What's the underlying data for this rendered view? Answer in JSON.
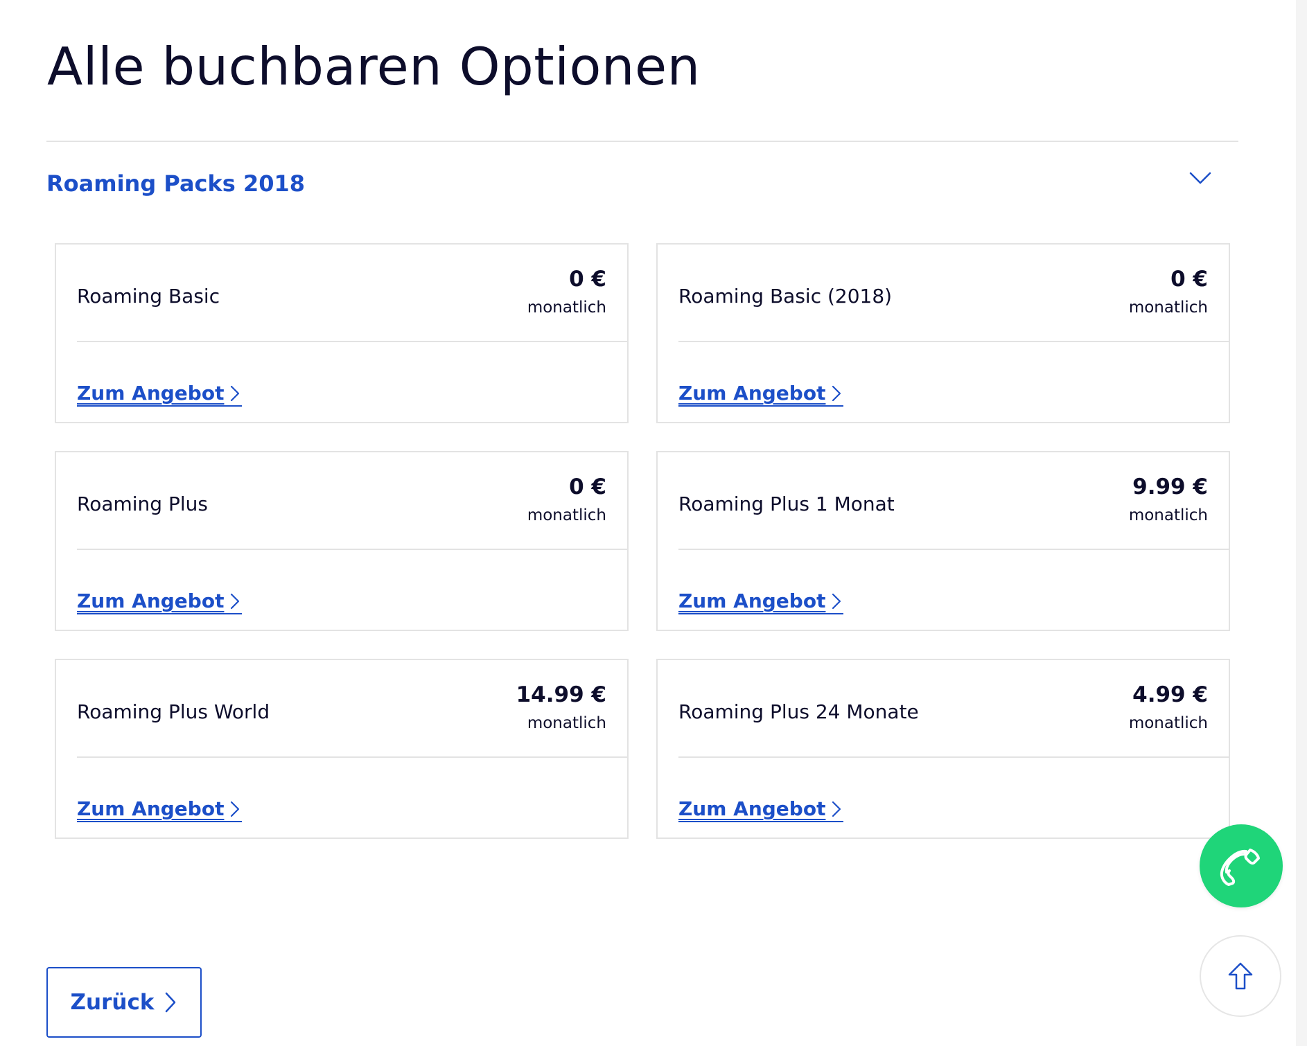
{
  "page": {
    "title": "Alle buchbaren Optionen"
  },
  "accordion": {
    "title": "Roaming Packs 2018",
    "expanded": true,
    "icon": "chevron-down-icon"
  },
  "offers": [
    {
      "name": "Roaming Basic",
      "price": "0 €",
      "period": "monatlich",
      "link": "Zum Angebot"
    },
    {
      "name": "Roaming Basic (2018)",
      "price": "0 €",
      "period": "monatlich",
      "link": "Zum Angebot"
    },
    {
      "name": "Roaming Plus",
      "price": "0 €",
      "period": "monatlich",
      "link": "Zum Angebot"
    },
    {
      "name": "Roaming Plus 1 Monat",
      "price": "9.99 €",
      "period": "monatlich",
      "link": "Zum Angebot"
    },
    {
      "name": "Roaming Plus World",
      "price": "14.99 €",
      "period": "monatlich",
      "link": "Zum Angebot"
    },
    {
      "name": "Roaming Plus 24 Monate",
      "price": "4.99 €",
      "period": "monatlich",
      "link": "Zum Angebot"
    }
  ],
  "footer": {
    "back_label": "Zurück"
  },
  "fabs": {
    "call_icon": "phone-icon",
    "top_icon": "arrow-up-icon"
  },
  "colors": {
    "accent": "#1c4fc8",
    "text": "#0d0d2b",
    "border": "#e3e3e3",
    "call": "#1fd579"
  }
}
